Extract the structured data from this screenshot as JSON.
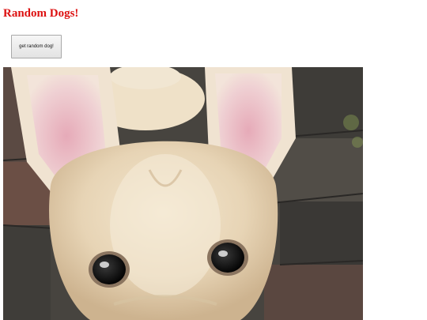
{
  "header": {
    "title": "Random Dogs!"
  },
  "controls": {
    "get_dog_label": "get random dog!"
  },
  "photo": {
    "subject": "dog-photo",
    "colors": {
      "fur": "#e8d8bd",
      "ear_inner": "#e9b7c2",
      "stone": "#4a4844",
      "brick": "#6b4c44"
    }
  },
  "colors": {
    "title": "#dd1111"
  }
}
